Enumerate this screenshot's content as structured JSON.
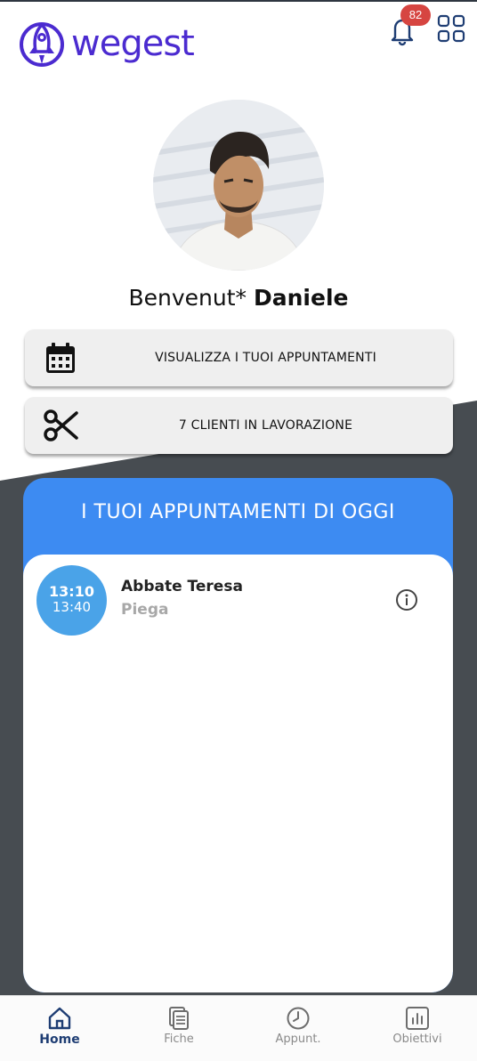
{
  "header": {
    "logo_text": "wegest",
    "notifications_count": "82"
  },
  "profile": {
    "welcome_prefix": "Benvenut*",
    "user_name": "Daniele"
  },
  "actions": {
    "appointments_label": "VISUALIZZA I TUOI APPUNTAMENTI",
    "clients_label": "7 CLIENTI IN LAVORAZIONE"
  },
  "today": {
    "title": "I TUOI APPUNTAMENTI DI OGGI",
    "appointments": [
      {
        "start": "13:10",
        "end": "13:40",
        "client": "Abbate Teresa",
        "service": "Piega"
      }
    ]
  },
  "nav": {
    "items": [
      {
        "label": "Home",
        "icon": "home-icon",
        "active": true
      },
      {
        "label": "Fiche",
        "icon": "documents-icon",
        "active": false
      },
      {
        "label": "Appunt.",
        "icon": "clock-icon",
        "active": false
      },
      {
        "label": "Obiettivi",
        "icon": "bar-chart-icon",
        "active": false
      }
    ]
  },
  "colors": {
    "brand": "#4b2bd0",
    "accent_blue": "#3d8bf2",
    "time_circle": "#4aa3e8",
    "dark_background": "#474c51",
    "badge": "#d64541",
    "nav_active": "#1e3d73"
  }
}
